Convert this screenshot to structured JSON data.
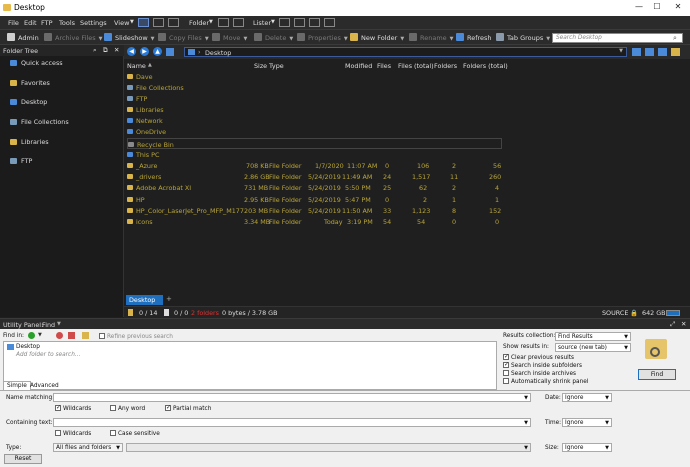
{
  "window": {
    "title": "Desktop"
  },
  "menu": [
    "File",
    "Edit",
    "FTP",
    "Tools",
    "Settings",
    "View"
  ],
  "toolbar": {
    "admin": "Admin",
    "archive": "Archive Files",
    "slideshow": "Slideshow",
    "copy": "Copy Files",
    "move": "Move",
    "delete": "Delete",
    "properties": "Properties",
    "new_folder": "New Folder",
    "rename": "Rename",
    "refresh": "Refresh",
    "tab_groups": "Tab Groups",
    "folder": "Folder",
    "lister": "Lister",
    "search_placeholder": "Search Desktop"
  },
  "nav": {
    "path": "Desktop"
  },
  "left_panel": {
    "title": "Folder Tree",
    "items": [
      "Quick access",
      "Favorites",
      "Desktop",
      "File Collections",
      "Libraries",
      "FTP"
    ]
  },
  "columns": [
    "Name",
    "Size",
    "Type",
    "Modified",
    "Files",
    "Files (total)",
    "Folders",
    "Folders (total)"
  ],
  "special_rows": [
    "Dave",
    "File Collections",
    "FTP",
    "Libraries",
    "Network",
    "OneDrive",
    "Recycle Bin",
    "This PC"
  ],
  "rows": [
    {
      "name": "_Azure",
      "size": "708 KB",
      "type": "File Folder",
      "modified": "1/7/2020",
      "time": "11:07 AM",
      "files": "0",
      "files_total": "106",
      "folders": "2",
      "folders_total": "56"
    },
    {
      "name": "_drivers",
      "size": "2.86 GB",
      "type": "File Folder",
      "modified": "5/24/2019",
      "time": "11:49 AM",
      "files": "24",
      "files_total": "1,517",
      "folders": "11",
      "folders_total": "260"
    },
    {
      "name": "Adobe Acrobat XI",
      "size": "731 MB",
      "type": "File Folder",
      "modified": "5/24/2019",
      "time": "5:50 PM",
      "files": "25",
      "files_total": "62",
      "folders": "2",
      "folders_total": "4"
    },
    {
      "name": "HP",
      "size": "2.95 KB",
      "type": "File Folder",
      "modified": "5/24/2019",
      "time": "5:47 PM",
      "files": "0",
      "files_total": "2",
      "folders": "1",
      "folders_total": "1"
    },
    {
      "name": "HP_Color_LaserJet_Pro_MFP_M177",
      "size": "203 MB",
      "type": "File Folder",
      "modified": "5/24/2019",
      "time": "11:50 AM",
      "files": "33",
      "files_total": "1,123",
      "folders": "8",
      "folders_total": "152"
    },
    {
      "name": "icons",
      "size": "3.34 MB",
      "type": "File Folder",
      "modified": "Today",
      "time": "3:19 PM",
      "files": "54",
      "files_total": "54",
      "folders": "0",
      "folders_total": "0"
    }
  ],
  "tab": {
    "label": "Desktop"
  },
  "status": {
    "sel_files": "0 / 14",
    "sel_folders": "0 / 0",
    "folders_red": "2 folders",
    "bytes": "0 bytes / 3.78 GB",
    "source": "SOURCE",
    "disk": "642 GB"
  },
  "utility": {
    "title": "Utility Panel:",
    "mode": "Find"
  },
  "find": {
    "find_in_label": "Find in:",
    "refine": "Refine previous search",
    "location": "Desktop",
    "add_folder": "Add folder to search...",
    "results_collection_label": "Results collection:",
    "results_collection": "Find Results",
    "show_results_label": "Show results in:",
    "show_results": "source (new tab)",
    "opt_clear": "Clear previous results",
    "opt_subfolders": "Search inside subfolders",
    "opt_archives": "Search inside archives",
    "opt_shrink": "Automatically shrink panel",
    "find_button": "Find",
    "tab_simple": "Simple",
    "tab_advanced": "Advanced",
    "name_label": "Name matching:",
    "wildcards": "Wildcards",
    "any_word": "Any word",
    "partial": "Partial match",
    "containing_label": "Containing text:",
    "wildcards2": "Wildcards",
    "case": "Case sensitive",
    "type_label": "Type:",
    "type_value": "All files and folders",
    "date_label": "Date:",
    "date_value": "Ignore",
    "time_label": "Time:",
    "time_value": "Ignore",
    "size_label": "Size:",
    "size_value": "Ignore",
    "reset": "Reset"
  },
  "colors": {
    "folder": "#d9b44a",
    "file_text": "#b9a53a",
    "accent": "#1f6fbf",
    "red": "#e03030"
  }
}
